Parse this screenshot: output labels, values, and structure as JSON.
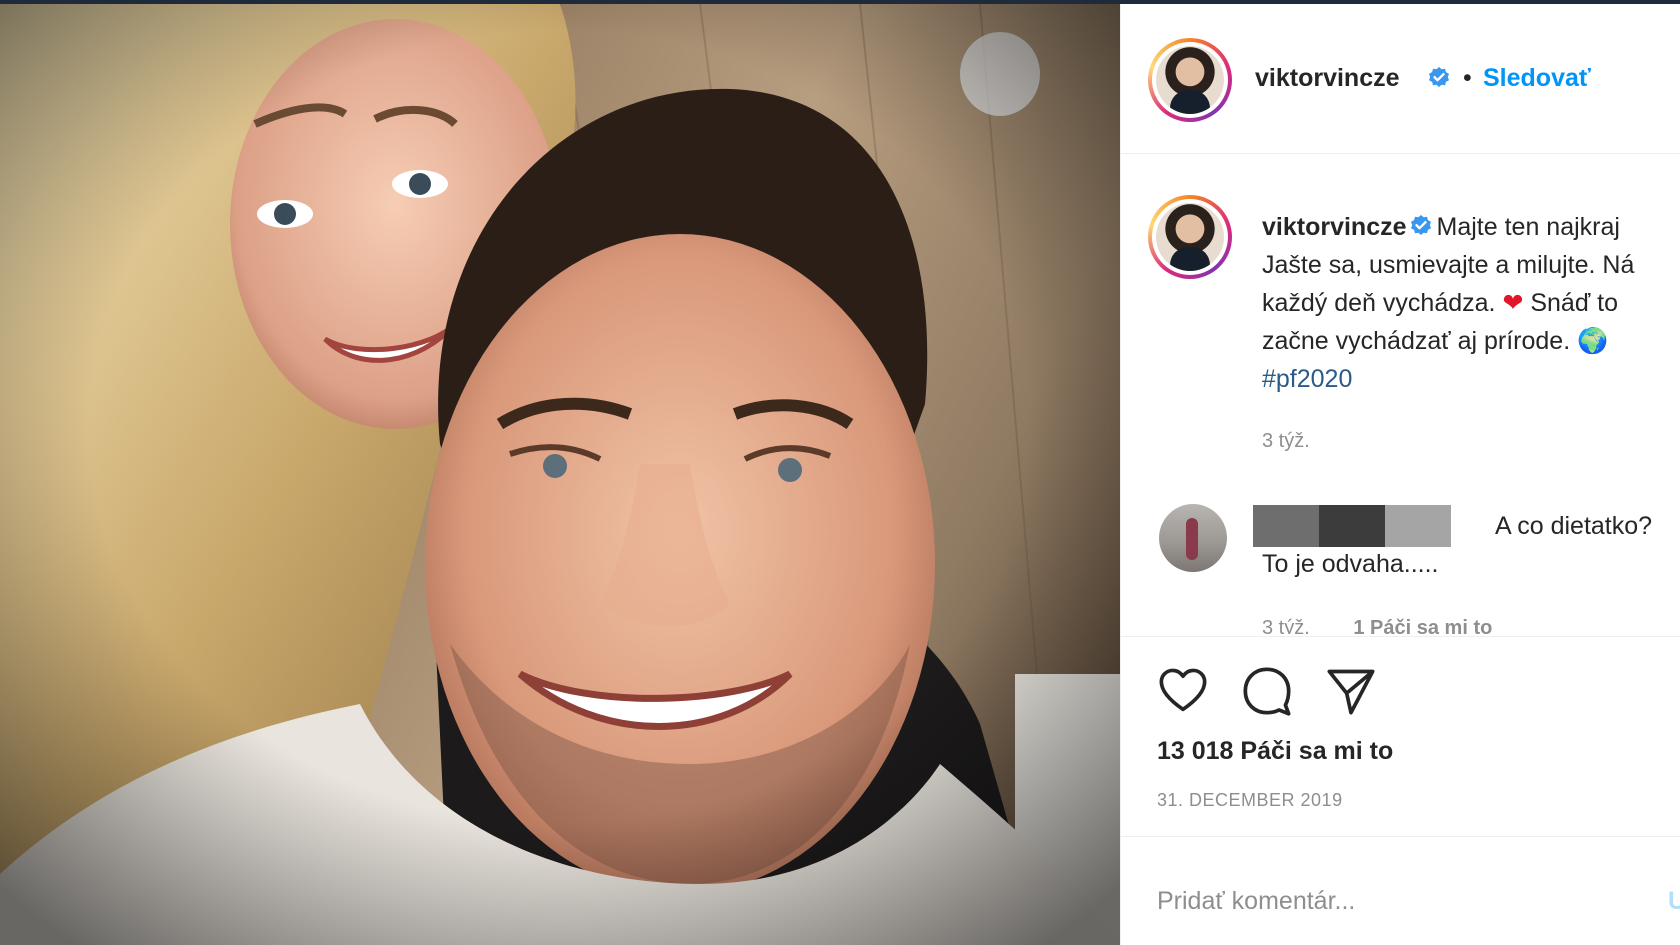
{
  "post": {
    "username": "viktorvincze",
    "follow_label": "Sledovať",
    "separator": "•",
    "caption_lines": [
      "Majte ten najkraj",
      "Jašte sa, usmievajte a milujte. Ná",
      "každý deň vychádza.",
      "❤",
      "Snáď to",
      "začne vychádzať aj prírode.",
      "🌍",
      "#pf2020"
    ],
    "caption_time": "3 týž.",
    "comment": {
      "text_line1": "A co dietatko?",
      "text_line2": "To je odvaha.....",
      "time": "3 týž.",
      "likes": "1 Páči sa mi to"
    },
    "likes_count": "13 018 Páči sa mi to",
    "date": "31. DECEMBER 2019",
    "add_comment_placeholder": "Pridať komentár...",
    "post_button": "U"
  },
  "icons": {
    "verified": "verified-badge-icon",
    "like": "heart-icon",
    "comment": "comment-bubble-icon",
    "share": "paper-plane-icon"
  },
  "colors": {
    "follow": "#0095f6",
    "verified": "#3897f0",
    "heart_emoji": "#e0162b",
    "muted": "#8e8e8e"
  }
}
